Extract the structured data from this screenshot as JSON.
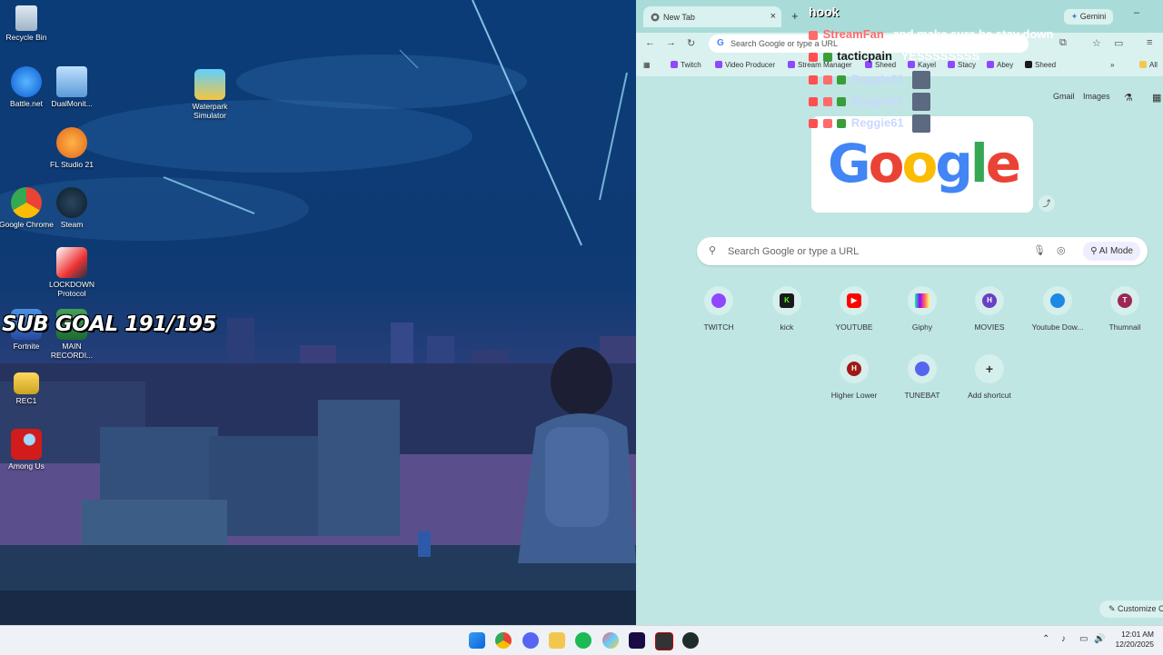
{
  "desktop": {
    "icons": [
      {
        "label": "Recycle Bin"
      },
      {
        "label": "Battle.net"
      },
      {
        "label": "DualMonit..."
      },
      {
        "label": "Waterpark Simulator"
      },
      {
        "label": "FL Studio 21"
      },
      {
        "label": "Google Chrome"
      },
      {
        "label": "Steam"
      },
      {
        "label": "LOCKDOWN Protocol"
      },
      {
        "label": "Fortnite"
      },
      {
        "label": "MAIN RECORDI..."
      },
      {
        "label": "REC1"
      },
      {
        "label": "Among Us"
      }
    ],
    "overlay_text": "SUB GOAL 191/195"
  },
  "browser": {
    "tab_title": "New Tab",
    "gemini_label": "Gemini",
    "omnibox_placeholder": "Search Google or type a URL",
    "bookmarks": [
      "Twitch",
      "Video Producer",
      "Stream Manager",
      "Sheed",
      "Kayel",
      "Stacy",
      "Abey",
      "Sheed"
    ],
    "bookmarks_more": "»",
    "all_bookmarks": "All",
    "top_links": {
      "gmail": "Gmail",
      "images": "Images"
    },
    "logo_text": "Google",
    "search_placeholder": "Search Google or type a URL",
    "ai_mode": "AI Mode",
    "shortcuts": [
      {
        "label": "TWITCH",
        "letter": "",
        "color": "#9146ff"
      },
      {
        "label": "kick",
        "letter": "K",
        "color": "#1a1a1a"
      },
      {
        "label": "YOUTUBE",
        "letter": "▶",
        "color": "#ff0000"
      },
      {
        "label": "Giphy",
        "letter": "",
        "color": "#8bd"
      },
      {
        "label": "MOVIES",
        "letter": "H",
        "color": "#6a3fc3"
      },
      {
        "label": "Youtube Dow...",
        "letter": "",
        "color": "#1e88e5"
      },
      {
        "label": "Thumnail",
        "letter": "T",
        "color": "#9c2756"
      },
      {
        "label": "Higher Lower",
        "letter": "H",
        "color": "#a01818"
      },
      {
        "label": "TUNEBAT",
        "letter": "",
        "color": "#5566ee"
      },
      {
        "label": "Add shortcut",
        "letter": "+",
        "color": "#d4efec"
      }
    ],
    "customize": "Customize C"
  },
  "chat": {
    "messages": [
      {
        "user": "",
        "text": "hook"
      },
      {
        "user": "StreamFan",
        "text": "and make sure he stay down"
      },
      {
        "user": "tacticpain",
        "text": "YESSSSSSSS"
      },
      {
        "user": "Reggie61",
        "text": ""
      },
      {
        "user": "Reggie61",
        "text": ""
      },
      {
        "user": "Reggie61",
        "text": ""
      }
    ]
  },
  "taskbar": {
    "time": "12:01 AM",
    "date": "12/20/2025"
  }
}
